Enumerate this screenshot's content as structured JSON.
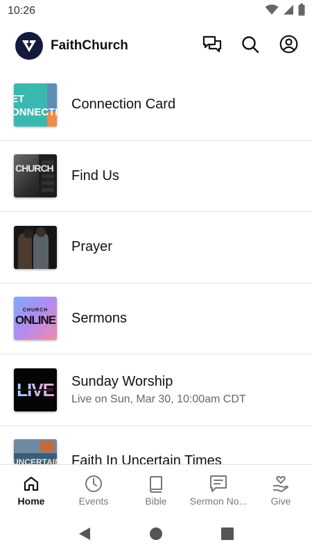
{
  "status_bar": {
    "time": "10:26"
  },
  "header": {
    "title": "FaithChurch"
  },
  "items": [
    {
      "title": "Connection Card",
      "subtitle": "",
      "thumb_text": "ET\nONNECTE"
    },
    {
      "title": "Find Us",
      "subtitle": "",
      "thumb_text": "CHURCH"
    },
    {
      "title": "Prayer",
      "subtitle": ""
    },
    {
      "title": "Sermons",
      "subtitle": "",
      "thumb_small": "CHURCH",
      "thumb_text": "ONLINE"
    },
    {
      "title": "Sunday Worship",
      "subtitle": "Live on Sun, Mar 30, 10:00am CDT",
      "thumb_text": "LIVE"
    },
    {
      "title": "Faith In Uncertain Times",
      "subtitle": "",
      "thumb_text": "UNCERTAIN"
    }
  ],
  "nav": [
    {
      "label": "Home",
      "icon": "home-icon",
      "active": true
    },
    {
      "label": "Events",
      "icon": "clock-icon",
      "active": false
    },
    {
      "label": "Bible",
      "icon": "book-icon",
      "active": false
    },
    {
      "label": "Sermon No...",
      "icon": "notes-icon",
      "active": false
    },
    {
      "label": "Give",
      "icon": "give-icon",
      "active": false
    }
  ],
  "colors": {
    "logo_bg": "#151a3d",
    "active_tab": "#111111",
    "inactive_tab": "#777777",
    "divider": "#e6e6e6"
  }
}
